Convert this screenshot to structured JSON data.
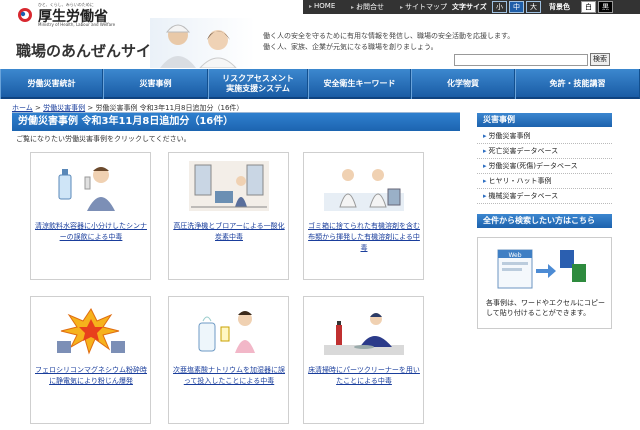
{
  "topbar": {
    "links": [
      "HOME",
      "お問合せ",
      "サイトマップ"
    ],
    "font_size_label": "文字サイズ",
    "font_sizes": [
      "小",
      "中",
      "大"
    ],
    "color_label": "背景色",
    "colors": [
      "白",
      "黒"
    ]
  },
  "header": {
    "tagline": "ひと、くらし、みらいのために",
    "ministry_name": "厚生労働省",
    "ministry_en": "Ministry of Health, Labour and Welfare",
    "site_title": "職場のあんぜんサイト",
    "intro_line1": "働く人の安全を守るために有用な情報を発信し、職場の安全活動を応援します。",
    "intro_line2": "働く人、家族、企業が元気になる職場を創りましょう。",
    "search_value": "",
    "search_button": "検索"
  },
  "nav": [
    "労働災害統計",
    "災害事例",
    "リスクアセスメント\n実施支援システム",
    "安全衛生キーワード",
    "化学物質",
    "免許・技能講習"
  ],
  "breadcrumb": {
    "home": "ホーム",
    "sep": " > ",
    "link": "労働災害事例",
    "current": "労働災害事例 令和3年11月8日追加分（16件）"
  },
  "main": {
    "title": "労働災害事例 令和3年11月8日追加分（16件）",
    "lead": "ご覧になりたい労働災害事例をクリックしてください。",
    "cards": [
      "清涼飲料水容器に小分けしたシンナーの誤飲による中毒",
      "高圧洗浄機とブロアーによる一酸化炭素中毒",
      "ゴミ箱に捨てられた有機溶剤を含む布類から揮発した有機溶剤による中毒",
      "フェロシリコンマグネシウム粉砕時に静電気により粉じん爆発",
      "次亜塩素酸ナトリウムを加湿器に誤って投入したことによる中毒",
      "床清掃時にパーツクリーナーを用いたことによる中毒"
    ]
  },
  "sidebar": {
    "head1": "災害事例",
    "items": [
      "労働災害事例",
      "死亡災害データベース",
      "労働災害(死傷)データベース",
      "ヒヤリ・ハット事例",
      "機械災害データベース"
    ],
    "head2": "全件から検索したい方はこちら",
    "box_text": "各事例は、ワードやエクセルにコピーして貼り付けることができます。",
    "illus_label": "Web"
  }
}
